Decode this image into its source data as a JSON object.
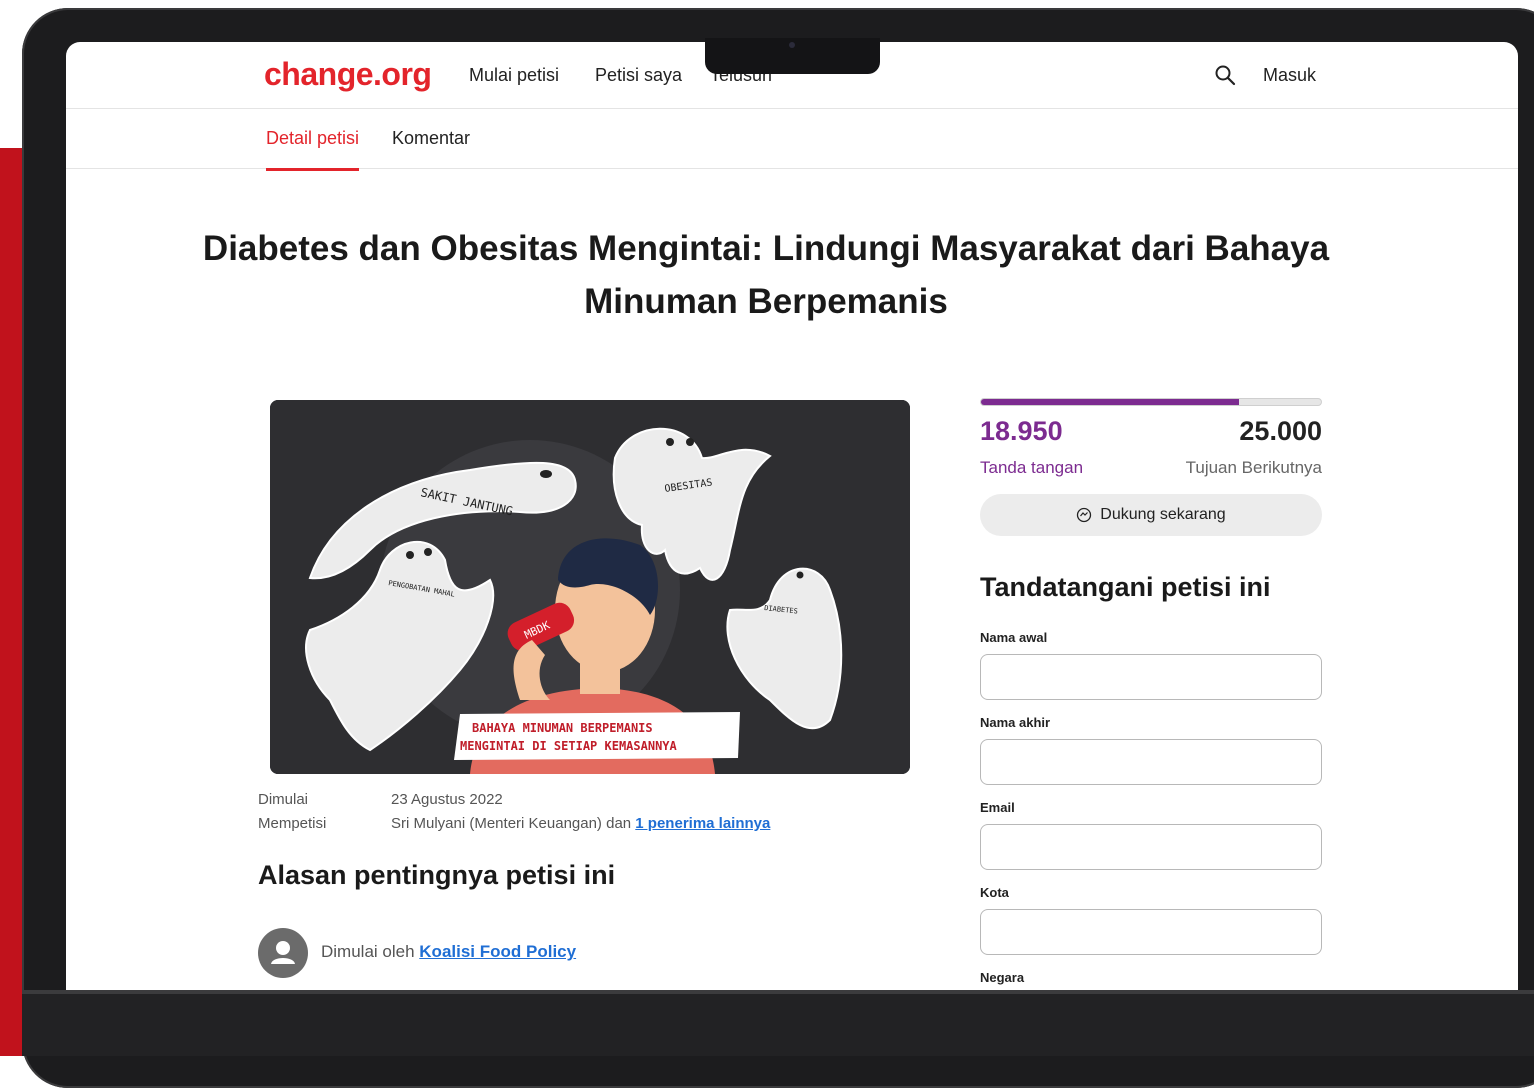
{
  "brand": {
    "logo_text": "change.org",
    "color": "#e3242b",
    "accent_purple": "#7c2b90"
  },
  "nav": {
    "items": [
      "Mulai petisi",
      "Petisi saya",
      "Telusuri"
    ],
    "search_icon": "search-icon",
    "login_label": "Masuk"
  },
  "tabs": [
    {
      "label": "Detail petisi",
      "active": true
    },
    {
      "label": "Komentar",
      "active": false
    }
  ],
  "petition": {
    "title": "Diabetes dan Obesitas Mengintai: Lindungi Masyarakat dari Bahaya Minuman Berpemanis",
    "image": {
      "ghost_labels": [
        "SAKIT JANTUNG",
        "OBESITAS",
        "PENGOBATAN MAHAL",
        "DIABETES"
      ],
      "can_label": "MBDK",
      "banner_line1": "BAHAYA MINUMAN BERPEMANIS",
      "banner_line2": "MENGINTAI DI SETIAP KEMASANNYA"
    },
    "meta": {
      "started_label": "Dimulai",
      "started_value": "23 Agustus 2022",
      "petitioning_label": "Mempetisi",
      "petitioning_value": "Sri Mulyani (Menteri Keuangan) dan",
      "petitioning_link": "1 penerima lainnya"
    },
    "reason_heading": "Alasan pentingnya petisi ini",
    "started_by_prefix": "Dimulai oleh",
    "started_by_name": "Koalisi Food Policy"
  },
  "progress": {
    "signatures": "18.950",
    "signatures_label": "Tanda tangan",
    "goal": "25.000",
    "goal_label": "Tujuan Berikutnya",
    "fraction": 0.758,
    "support_button": "Dukung sekarang",
    "support_icon": "hands-icon"
  },
  "sign_form": {
    "heading": "Tandatangani petisi ini",
    "fields": [
      {
        "label": "Nama awal",
        "value": ""
      },
      {
        "label": "Nama akhir",
        "value": ""
      },
      {
        "label": "Email",
        "value": ""
      },
      {
        "label": "Kota",
        "value": ""
      },
      {
        "label": "Negara",
        "value": ""
      }
    ]
  }
}
